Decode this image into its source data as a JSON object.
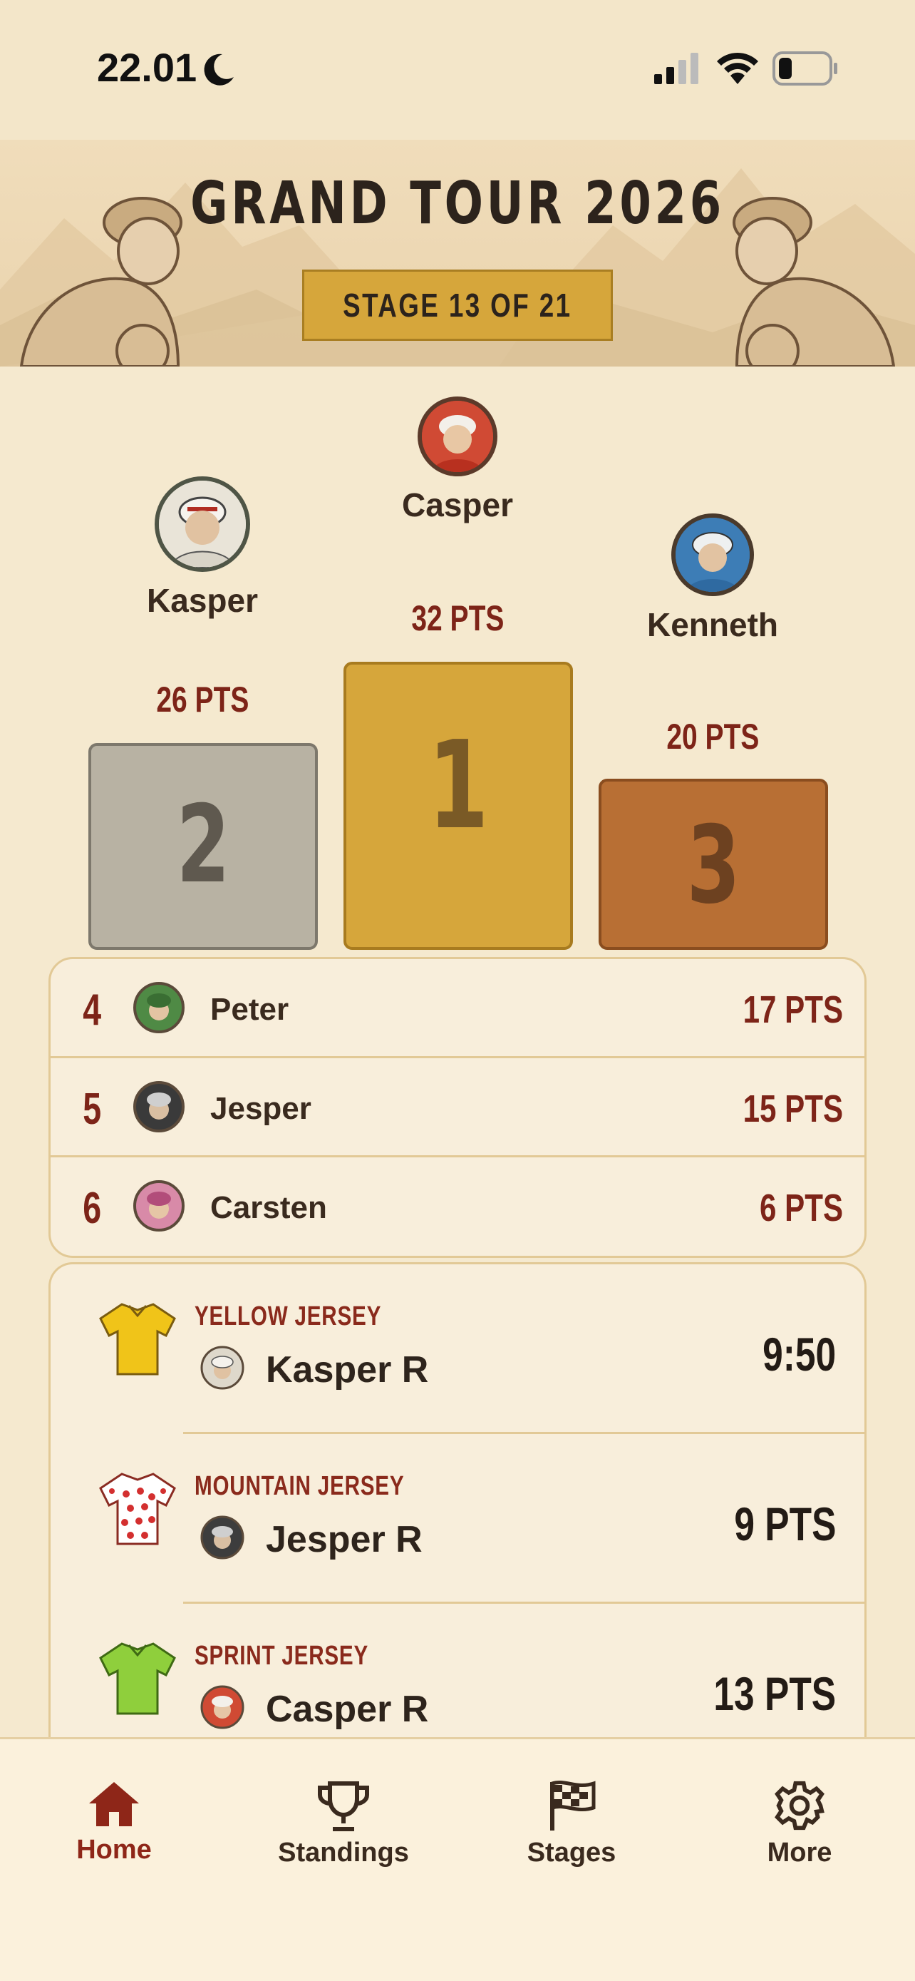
{
  "status_bar": {
    "time": "22.01"
  },
  "banner": {
    "title": "GRAND TOUR 2026",
    "stage": "STAGE 13 OF 21"
  },
  "podium": {
    "first": {
      "name": "Casper",
      "points": "32 PTS",
      "rank": "1"
    },
    "second": {
      "name": "Kasper",
      "points": "26 PTS",
      "rank": "2"
    },
    "third": {
      "name": "Kenneth",
      "points": "20 PTS",
      "rank": "3"
    }
  },
  "ranking": [
    {
      "rank": "4",
      "name": "Peter",
      "points": "17 PTS"
    },
    {
      "rank": "5",
      "name": "Jesper",
      "points": "15 PTS"
    },
    {
      "rank": "6",
      "name": "Carsten",
      "points": "6 PTS"
    }
  ],
  "jerseys": [
    {
      "type": "YELLOW JERSEY",
      "holder": "Kasper R",
      "value": "9:50",
      "color": "#f0c419"
    },
    {
      "type": "MOUNTAIN JERSEY",
      "holder": "Jesper R",
      "value": "9 PTS",
      "color": "#ffffff"
    },
    {
      "type": "SPRINT JERSEY",
      "holder": "Casper R",
      "value": "13 PTS",
      "color": "#8fcf3c"
    }
  ],
  "tabs": [
    {
      "label": "Home",
      "icon": "home-icon",
      "active": true
    },
    {
      "label": "Standings",
      "icon": "trophy-icon",
      "active": false
    },
    {
      "label": "Stages",
      "icon": "checkered-flag-icon",
      "active": false
    },
    {
      "label": "More",
      "icon": "gear-icon",
      "active": false
    }
  ],
  "colors": {
    "background": "#f5e9cf",
    "accent_red": "#7d2418",
    "gold": "#d6a63b",
    "silver": "#b8b2a3",
    "bronze": "#b86f34"
  }
}
